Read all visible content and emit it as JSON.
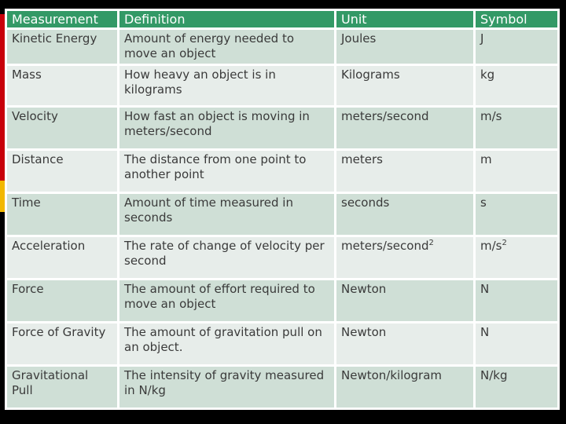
{
  "table": {
    "headers": [
      "Measurement",
      "Definition",
      "Unit",
      "Symbol"
    ],
    "rows": [
      {
        "measurement": "Kinetic Energy",
        "definition": "Amount of energy needed to move an object",
        "unit": "Joules",
        "unit_sup": "",
        "symbol": "J",
        "symbol_sup": ""
      },
      {
        "measurement": "Mass",
        "definition": "How heavy an object is in kilograms",
        "unit": "Kilograms",
        "unit_sup": "",
        "symbol": "kg",
        "symbol_sup": ""
      },
      {
        "measurement": "Velocity",
        "definition": "How fast an object is moving in meters/second",
        "unit": "meters/second",
        "unit_sup": "",
        "symbol": "m/s",
        "symbol_sup": ""
      },
      {
        "measurement": "Distance",
        "definition": "The distance from one point to another point",
        "unit": "meters",
        "unit_sup": "",
        "symbol": "m",
        "symbol_sup": ""
      },
      {
        "measurement": "Time",
        "definition": "Amount of time measured in seconds",
        "unit": "seconds",
        "unit_sup": "",
        "symbol": "s",
        "symbol_sup": ""
      },
      {
        "measurement": "Acceleration",
        "definition": "The rate of change of velocity per second",
        "unit": "meters/second",
        "unit_sup": "2",
        "symbol": "m/s",
        "symbol_sup": "2"
      },
      {
        "measurement": "Force",
        "definition": "The amount of effort required to move an object",
        "unit": "Newton",
        "unit_sup": "",
        "symbol": "N",
        "symbol_sup": ""
      },
      {
        "measurement": "Force of Gravity",
        "definition": "The amount of gravitation pull on an object.",
        "unit": "Newton",
        "unit_sup": "",
        "symbol": "N",
        "symbol_sup": ""
      },
      {
        "measurement": "Gravitational Pull",
        "definition": "The intensity of gravity measured in N/kg",
        "unit": "Newton/kilogram",
        "unit_sup": "",
        "symbol": "N/kg",
        "symbol_sup": ""
      }
    ]
  },
  "colors": {
    "header_bg": "#339966",
    "row_dark": "#cfdfd6",
    "row_light": "#e7edea",
    "accent_red": "#c8000a",
    "accent_yellow": "#f2b800"
  }
}
